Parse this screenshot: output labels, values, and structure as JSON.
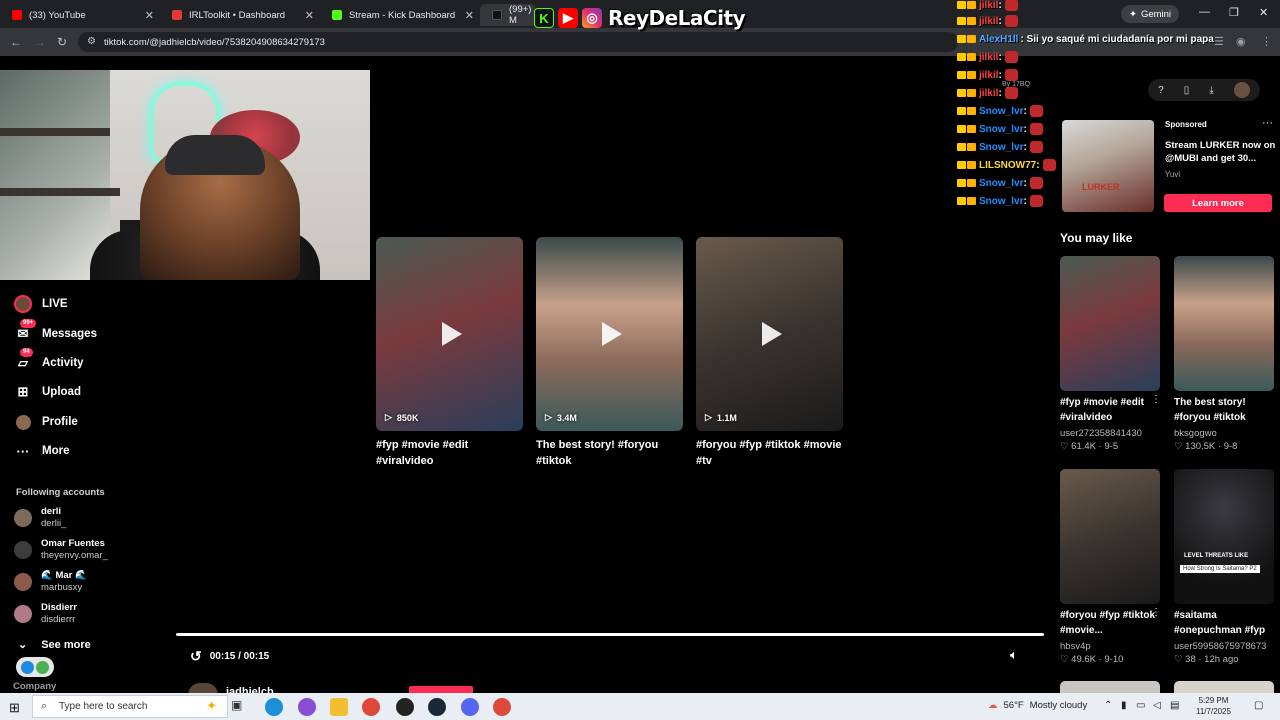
{
  "browser": {
    "tabs": [
      {
        "label": "(33) YouTube",
        "icon_color": "#ff0000"
      },
      {
        "label": "IRLToolkit • Dashboard",
        "icon_color": "#e53935"
      },
      {
        "label": "Stream - Kick Dashboard",
        "icon_color": "#53fc18"
      },
      {
        "label": "(99+) M",
        "icon_color": "#111111"
      }
    ],
    "gemini_label": "Gemini",
    "url": "tiktok.com/@jadhielcb/video/7538204908634279173"
  },
  "overlay": {
    "streamer_name": "ReyDeLaCity",
    "kick_letter": "K"
  },
  "chat": [
    {
      "user": "jilkil",
      "user_color": "#ff4040",
      "message": ""
    },
    {
      "user": "jilkil",
      "user_color": "#ff4040",
      "message": ""
    },
    {
      "user": "AlexH1ll",
      "user_color": "#4aa8ff",
      "message": ": Sii yo saqué mi ciudadanía por mi papa"
    },
    {
      "user": "jilkil",
      "user_color": "#ff4040",
      "message": ""
    },
    {
      "user": "jilkil",
      "user_color": "#ff4040",
      "message": ""
    },
    {
      "user": "jilkil",
      "user_color": "#ff4040",
      "message": ""
    },
    {
      "user": "Snow_lvr",
      "user_color": "#1e90ff",
      "message": ""
    },
    {
      "user": "Snow_lvr",
      "user_color": "#1e90ff",
      "message": ""
    },
    {
      "user": "Snow_lvr",
      "user_color": "#1e90ff",
      "message": ""
    },
    {
      "user": "LILSNOW77",
      "user_color": "#ffd43b",
      "message": ""
    },
    {
      "user": "Snow_lvr",
      "user_color": "#1e90ff",
      "message": ""
    },
    {
      "user": "Snow_lvr",
      "user_color": "#1e90ff",
      "message": ""
    }
  ],
  "chat_cam_label": "By 17BQ",
  "sidebar": {
    "items": [
      {
        "label": "LIVE",
        "icon": "live-avatar-icon"
      },
      {
        "label": "Messages",
        "icon": "messages-icon",
        "badge": "99+"
      },
      {
        "label": "Activity",
        "icon": "activity-icon",
        "badge": "94"
      },
      {
        "label": "Upload",
        "icon": "upload-icon"
      },
      {
        "label": "Profile",
        "icon": "profile-icon"
      },
      {
        "label": "More",
        "icon": "more-icon"
      }
    ],
    "following_title": "Following accounts",
    "following": [
      {
        "name": "derli",
        "username": "derlii_"
      },
      {
        "name": "Omar Fuentes",
        "username": "theyenvy.omar_"
      },
      {
        "name": "🌊 Mar 🌊",
        "username": "marbusxy"
      },
      {
        "name": "Disdierr",
        "username": "disdierrr"
      }
    ],
    "see_more": "See more",
    "company": "Company"
  },
  "videos": [
    {
      "views": "850K",
      "caption": "#fyp #movie #edit #viralvideo"
    },
    {
      "views": "3.4M",
      "caption": "The best story! #foryou #tiktok"
    },
    {
      "views": "1.1M",
      "caption": "#foryou #fyp #tiktok #movie #tv"
    }
  ],
  "player": {
    "time": "00:15 / 00:15",
    "progress": 1.0,
    "author": "jadhielcb"
  },
  "ad": {
    "sponsored": "Sponsored",
    "title": "Stream LURKER now on @MUBI and get 30...",
    "brand": "Yuvi",
    "cta": "Learn more",
    "thumb_text": "LURKER"
  },
  "you_may_like": {
    "title": "You may like",
    "items": [
      {
        "caption": "#fyp #movie #edit #viralvideo",
        "author": "user272358841430",
        "stats": "61.4K · 9-5"
      },
      {
        "caption": "The best story! #foryou #tiktok",
        "author": "bksgogwo",
        "stats": "130.5K · 9-8"
      },
      {
        "caption": "#foryou #fyp #tiktok #movie...",
        "author": "hbsv4p",
        "stats": "49.6K · 9-10"
      },
      {
        "caption": "#saitama #onepuchman #fyp",
        "author": "user59958675978673",
        "stats": "38 · 12h ago",
        "thumb_text": "LEVEL THREATS LIKE",
        "thumb_sub": "How Strong Is Saitama? P2"
      }
    ]
  },
  "taskbar": {
    "search_placeholder": "Type here to search",
    "weather_temp": "56°F",
    "weather_text": "Mostly cloudy",
    "time": "5:29 PM",
    "date": "11/7/2025"
  }
}
